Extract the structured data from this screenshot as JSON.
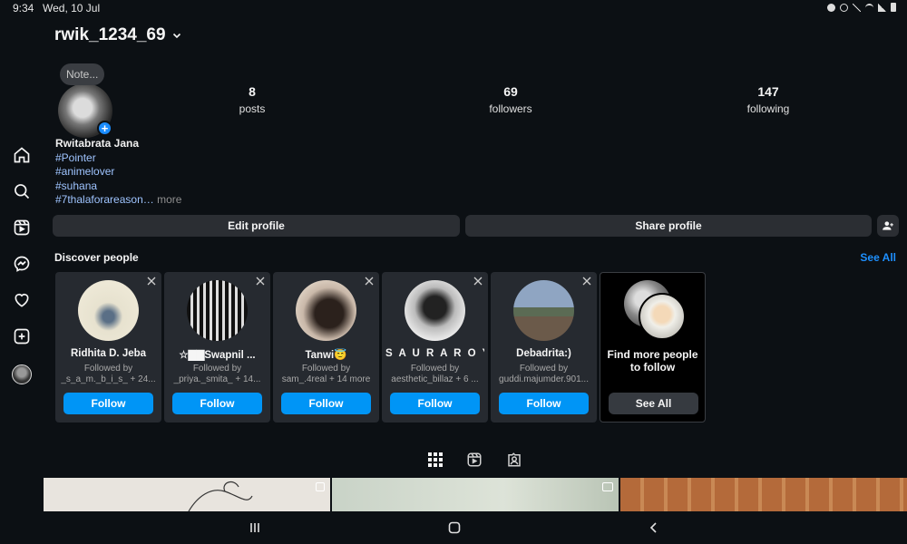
{
  "status_bar": {
    "time": "9:34",
    "date": "Wed, 10 Jul"
  },
  "sidebar": {
    "items": [
      {
        "icon": "home-icon"
      },
      {
        "icon": "search-icon"
      },
      {
        "icon": "reels-icon"
      },
      {
        "icon": "messenger-icon"
      },
      {
        "icon": "heart-icon"
      },
      {
        "icon": "create-icon"
      },
      {
        "icon": "profile-avatar"
      }
    ]
  },
  "profile": {
    "username": "rwik_1234_69",
    "note": "Note...",
    "stats": [
      {
        "value": "8",
        "label": "posts"
      },
      {
        "value": "69",
        "label": "followers"
      },
      {
        "value": "147",
        "label": "following"
      }
    ],
    "display_name": "Rwitabrata Jana",
    "bio_lines": [
      "#Pointer",
      "#animelover",
      "#suhana",
      "#7thalaforareason…"
    ],
    "bio_more": "more"
  },
  "actions": {
    "edit_profile": "Edit profile",
    "share_profile": "Share profile"
  },
  "discover": {
    "title": "Discover people",
    "see_all": "See All",
    "cards": [
      {
        "name": "Ridhita D. Jeba",
        "followed_by_label": "Followed by",
        "followed_by": "_s_a_m._b_i_s_ + 24...",
        "button": "Follow"
      },
      {
        "name": "☆▇▇Swapnil ...",
        "followed_by_label": "Followed by",
        "followed_by": "_priya._smita_ + 14...",
        "button": "Follow"
      },
      {
        "name": "Tanwi😇",
        "followed_by_label": "Followed by",
        "followed_by": "sam_.4real + 14 more",
        "button": "Follow"
      },
      {
        "name": "S A U R A  R O Y",
        "followed_by_label": "Followed by",
        "followed_by": "aesthetic_billaz + 6 ...",
        "button": "Follow"
      },
      {
        "name": "Debadrita:)",
        "followed_by_label": "Followed by",
        "followed_by": "guddi.majumder.901...",
        "button": "Follow"
      }
    ],
    "find_more": {
      "text": "Find more people to follow",
      "button": "See All"
    }
  },
  "colors": {
    "accent": "#0095f6",
    "link": "#1e90ff",
    "background": "#0c1014",
    "surface": "#262a30"
  }
}
